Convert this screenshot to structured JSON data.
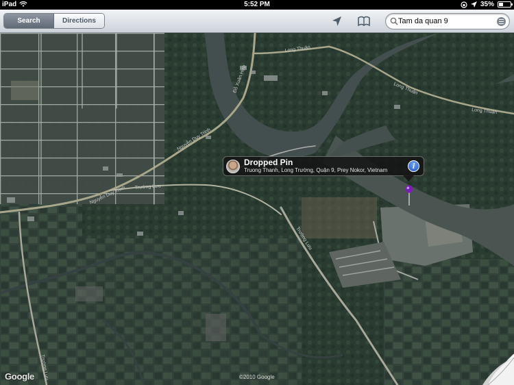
{
  "status_bar": {
    "device": "iPad",
    "time": "5:52 PM",
    "battery": "35%"
  },
  "toolbar": {
    "search_tab": "Search",
    "directions_tab": "Directions",
    "search_value": "Tam da quan 9"
  },
  "map": {
    "road_labels": [
      "Long Thuận",
      "Long Thuận",
      "Long Thuận",
      "Nguyễn Duy Trinh",
      "Nguyễn Duy Trinh",
      "Trường Lưu",
      "Đỗ Xuân Hợp",
      "Trường Lưu",
      "Trường Lưu"
    ],
    "google_logo": "Google",
    "copyright": "©2010 Google"
  },
  "callout": {
    "title": "Dropped Pin",
    "subtitle": "Truong Thanh, Long Trường, Quận 9, Prey Nokor, Vietnam"
  },
  "colors": {
    "pin": "#7a1fb4",
    "info_button": "#2c63d0"
  }
}
